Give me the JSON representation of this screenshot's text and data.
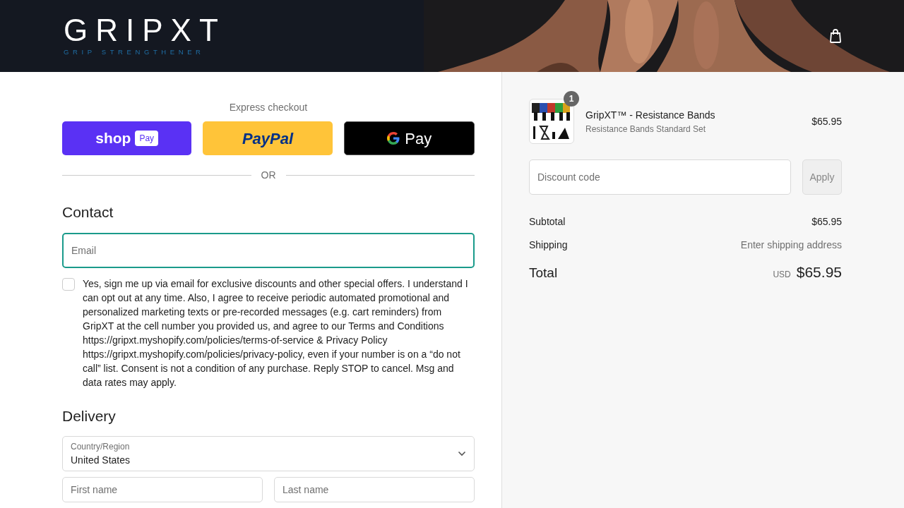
{
  "header": {
    "logo": "GRIPXT",
    "tagline": "GRIP STRENGTHENER"
  },
  "express_checkout": {
    "title": "Express checkout",
    "buttons": [
      {
        "kind": "shop",
        "label": "shop",
        "badge": "Pay"
      },
      {
        "kind": "paypal",
        "label": "PayPal"
      },
      {
        "kind": "gpay",
        "label": "Pay"
      }
    ],
    "divider": "OR"
  },
  "contact": {
    "heading": "Contact",
    "email": {
      "placeholder": "Email",
      "focused": true
    },
    "consent": {
      "checked": false,
      "text": "Yes, sign me up via email for exclusive discounts and other special offers. I understand I can opt out at any time. Also, I agree to receive periodic automated promotional and personalized marketing texts or pre-recorded messages (e.g. cart reminders) from GripXT at the cell number you provided us, and agree to our Terms and Conditions https://gripxt.myshopify.com/policies/terms-of-service & Privacy Policy https://gripxt.myshopify.com/policies/privacy-policy, even if your number is on a “do not call” list. Consent is not a condition of any purchase. Reply STOP to cancel. Msg and data rates may apply."
    }
  },
  "delivery": {
    "heading": "Delivery",
    "country": {
      "label": "Country/Region",
      "value": "United States"
    },
    "fields": [
      {
        "placeholder": "First name"
      },
      {
        "placeholder": "Last name"
      }
    ]
  },
  "summary": {
    "item": {
      "quantity": "1",
      "name": "GripXT™ - Resistance Bands",
      "variant": "Resistance Bands Standard Set",
      "price": "$65.95"
    },
    "discount": {
      "placeholder": "Discount code",
      "button": "Apply"
    },
    "lines": [
      {
        "label": "Subtotal",
        "value": "$65.95",
        "muted": false
      },
      {
        "label": "Shipping",
        "value": "Enter shipping address",
        "muted": true
      }
    ],
    "total": {
      "label": "Total",
      "currency": "USD",
      "value": "$65.95"
    }
  }
}
